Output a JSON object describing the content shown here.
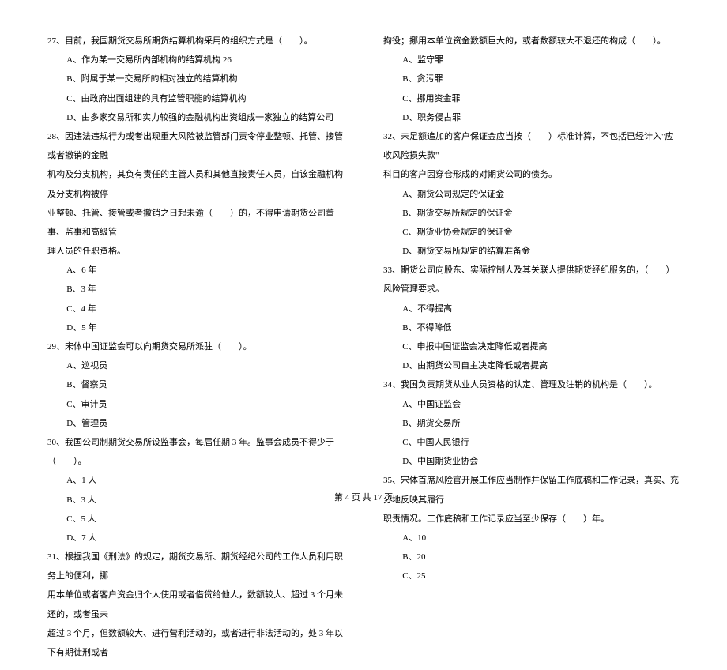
{
  "left": {
    "q27": {
      "text": "27、目前，我国期货交易所期货结算机构采用的组织方式是（　　）。",
      "a": "A、作为某一交易所内部机构的结算机构 26",
      "b": "B、附属于某一交易所的相对独立的结算机构",
      "c": "C、由政府出面组建的具有监管职能的结算机构",
      "d": "D、由多家交易所和实力较强的金融机构出资组成一家独立的结算公司"
    },
    "q28": {
      "l1": "28、因违法违规行为或者出现重大风险被监管部门责令停业整顿、托管、接管或者撤销的金融",
      "l2": "机构及分支机构，其负有责任的主管人员和其他直接责任人员，自该金融机构及分支机构被停",
      "l3": "业整顿、托管、接管或者撤销之日起未逾（　　）的，不得申请期货公司董事、监事和高级管",
      "l4": "理人员的任职资格。",
      "a": "A、6 年",
      "b": "B、3 年",
      "c": "C、4 年",
      "d": "D、5 年"
    },
    "q29": {
      "text": "29、宋体中国证监会可以向期货交易所派驻（　　）。",
      "a": "A、巡视员",
      "b": "B、督察员",
      "c": "C、审计员",
      "d": "D、管理员"
    },
    "q30": {
      "text": "30、我国公司制期货交易所设监事会，每届任期 3 年。监事会成员不得少于（　　）。",
      "a": "A、1 人",
      "b": "B、3 人",
      "c": "C、5 人",
      "d": "D、7 人"
    },
    "q31": {
      "l1": "31、根据我国《刑法》的规定，期货交易所、期货经纪公司的工作人员利用职务上的便利，挪",
      "l2": "用本单位或者客户资金归个人使用或者借贷给他人，数额较大、超过 3 个月未还的，或者虽未",
      "l3": "超过 3 个月，但数额较大、进行营利活动的，或者进行非法活动的，处 3 年以下有期徒刑或者"
    }
  },
  "right": {
    "q31cont": {
      "l1": "拘役；挪用本单位资金数额巨大的，或者数额较大不退还的构成（　　）。",
      "a": "A、监守罪",
      "b": "B、贪污罪",
      "c": "C、挪用资金罪",
      "d": "D、职务侵占罪"
    },
    "q32": {
      "l1": "32、未足额追加的客户保证金应当按（　　）标准计算，不包括已经计入\"应收风险损失款\"",
      "l2": "科目的客户因穿仓形成的对期货公司的债务。",
      "a": "A、期货公司规定的保证金",
      "b": "B、期货交易所规定的保证金",
      "c": "C、期货业协会规定的保证金",
      "d": "D、期货交易所规定的结算准备金"
    },
    "q33": {
      "text": "33、期货公司向股东、实际控制人及其关联人提供期货经纪服务的，（　　）风险管理要求。",
      "a": "A、不得提高",
      "b": "B、不得降低",
      "c": "C、申报中国证监会决定降低或者提高",
      "d": "D、由期货公司自主决定降低或者提高"
    },
    "q34": {
      "text": "34、我国负责期货从业人员资格的认定、管理及注销的机构是（　　）。",
      "a": "A、中国证监会",
      "b": "B、期货交易所",
      "c": "C、中国人民银行",
      "d": "D、中国期货业协会"
    },
    "q35": {
      "l1": "35、宋体首席风险官开展工作应当制作并保留工作底稿和工作记录，真实、充分地反映其履行",
      "l2": "职责情况。工作底稿和工作记录应当至少保存（　　）年。",
      "a": "A、10",
      "b": "B、20",
      "c": "C、25"
    }
  },
  "footer": "第 4 页 共 17 页"
}
